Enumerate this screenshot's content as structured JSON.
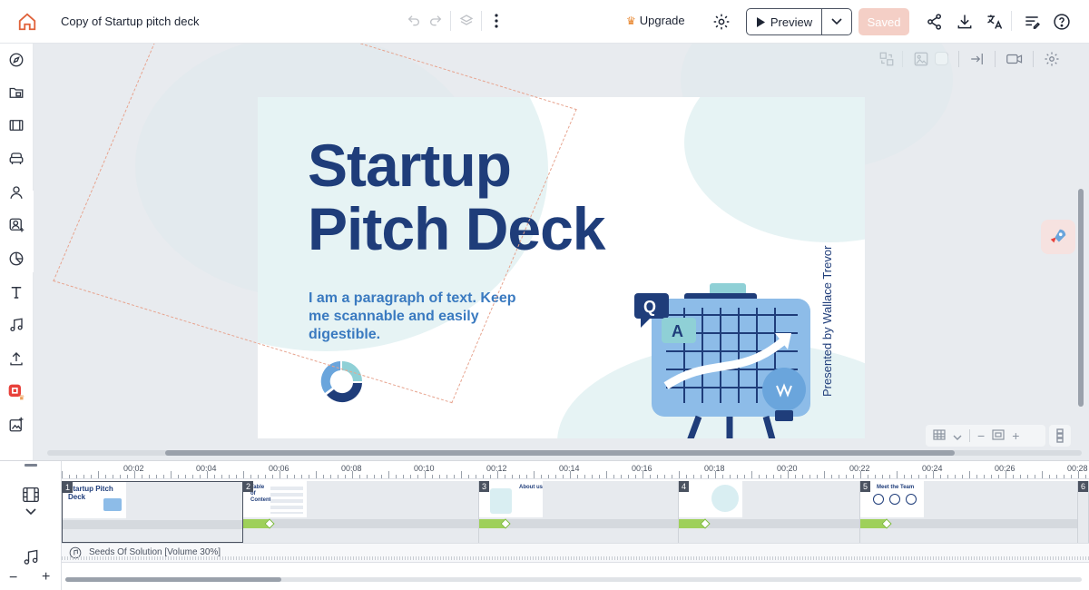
{
  "header": {
    "doc_title": "Copy of Startup pitch deck",
    "upgrade_label": "Upgrade",
    "preview_label": "Preview",
    "saved_label": "Saved",
    "colors": {
      "saved_bg": "#f4cfc6",
      "accent": "#e8852c"
    }
  },
  "sidebar": {
    "items": [
      "compass-icon",
      "templates-icon",
      "scenes-icon",
      "elements-icon",
      "characters-icon",
      "avatar-icon",
      "chart-icon",
      "text-icon",
      "music-icon",
      "upload-icon",
      "brand-icon",
      "ai-media-icon"
    ]
  },
  "slide": {
    "title_line1": "Startup",
    "title_line2": "Pitch Deck",
    "paragraph": "I am a paragraph of text. Keep me scannable and easily digestible.",
    "presented_by": "Presented by Wallace Trevor",
    "q_label": "Q",
    "a_label": "A"
  },
  "timeline": {
    "ruler": [
      "00:02",
      "00:04",
      "00:06",
      "00:08",
      "00:10",
      "00:12",
      "00:14",
      "00:16",
      "00:18",
      "00:20",
      "00:22",
      "00:24",
      "00:26",
      "00:28"
    ],
    "scenes": [
      {
        "num": "1",
        "title": "Startup Pitch Deck"
      },
      {
        "num": "2",
        "title": "Table of Contents"
      },
      {
        "num": "3",
        "title": "About us"
      },
      {
        "num": "4",
        "title": ""
      },
      {
        "num": "5",
        "title": "Meet the Team"
      },
      {
        "num": "6",
        "title": ""
      }
    ],
    "audio_label": "Seeds Of Solution [Volume 30%]",
    "zoom_minus": "−",
    "zoom_plus": "+"
  }
}
